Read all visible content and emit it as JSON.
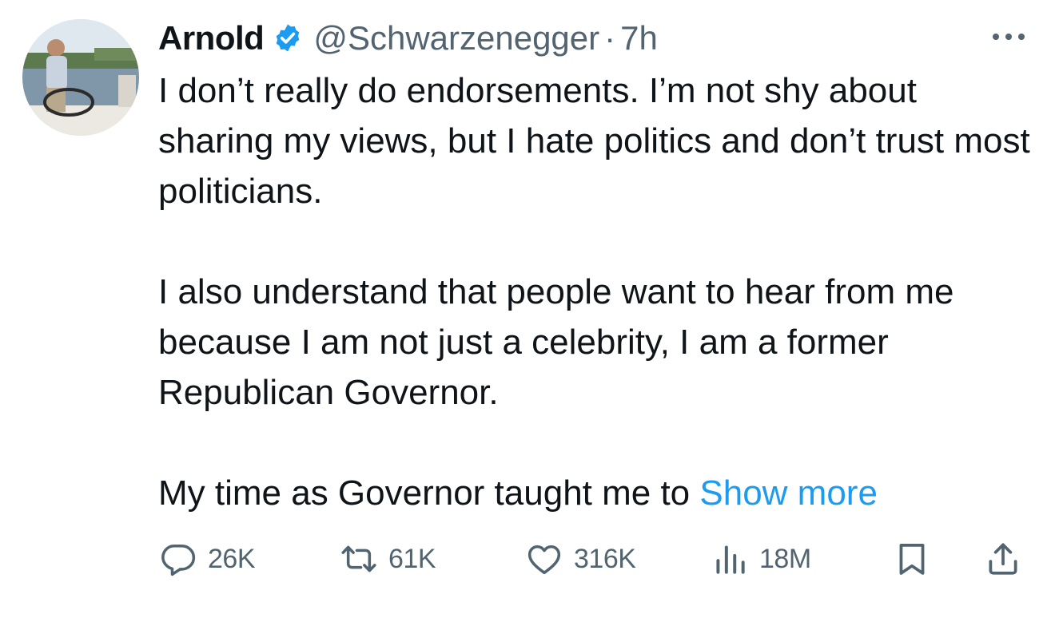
{
  "author": {
    "name": "Arnold",
    "handle": "@Schwarzenegger",
    "separator": "·",
    "time": "7h",
    "verified": true
  },
  "tweet": {
    "paragraphs": [
      "I don’t really do endorsements. I’m not shy about sharing my views, but I hate politics and don’t trust most politicians.",
      "I also understand that people want to hear from me because I am not just a celebrity, I am a former Republican Governor."
    ],
    "truncated_text": "My time as Governor taught me to ",
    "show_more_label": "Show more"
  },
  "actions": {
    "replies": "26K",
    "retweets": "61K",
    "likes": "316K",
    "views": "18M"
  },
  "icons": {
    "more": "more-horizontal-icon",
    "verified": "verified-badge-icon",
    "reply": "reply-icon",
    "retweet": "retweet-icon",
    "like": "heart-icon",
    "views": "analytics-icon",
    "bookmark": "bookmark-icon",
    "share": "share-icon"
  },
  "colors": {
    "text": "#0f1419",
    "secondary": "#536471",
    "link": "#1d9bf0",
    "verified": "#1d9bf0"
  }
}
